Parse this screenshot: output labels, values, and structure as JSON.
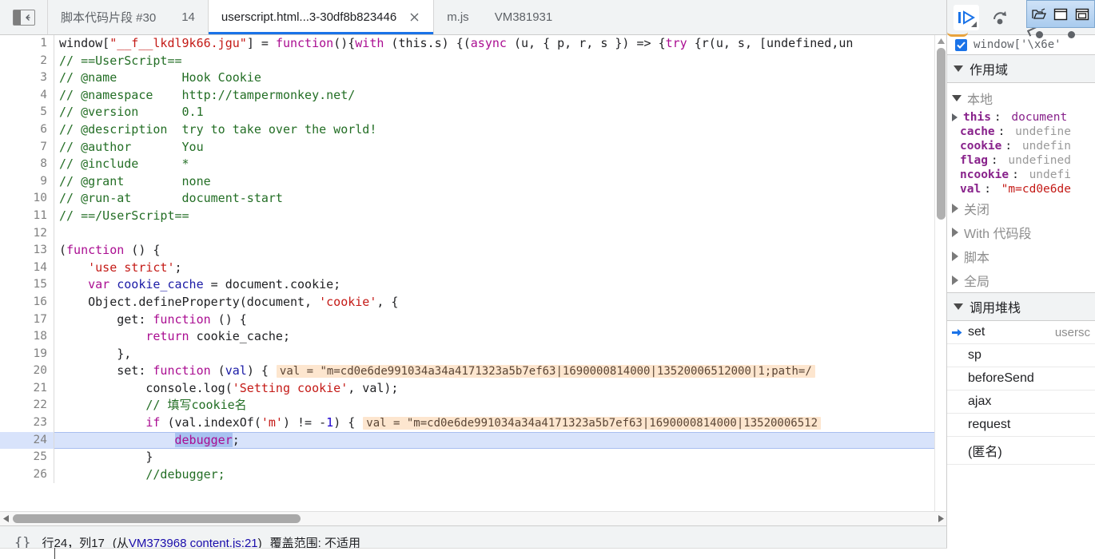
{
  "toolbar": {
    "nav_toggle_title": "收起导航栏",
    "tabs": [
      {
        "label": "脚本代码片段 #30",
        "active": false,
        "closable": false
      },
      {
        "label": "14",
        "active": false,
        "closable": false
      },
      {
        "label": "userscript.html...3-30df8b823446",
        "active": true,
        "closable": true
      },
      {
        "label": "m.js",
        "active": false,
        "closable": false
      },
      {
        "label": "VM381931",
        "active": false,
        "closable": false
      }
    ]
  },
  "editor": {
    "lines": [
      {
        "num": "1",
        "tokens": [
          {
            "t": "window[",
            "c": "t-plain"
          },
          {
            "t": "\"__f__lkdl9k66.jgu\"",
            "c": "t-str"
          },
          {
            "t": "] = ",
            "c": "t-plain"
          },
          {
            "t": "function",
            "c": "t-kw2"
          },
          {
            "t": "(){",
            "c": "t-plain"
          },
          {
            "t": "with",
            "c": "t-kw2"
          },
          {
            "t": " (this.s) {(",
            "c": "t-plain"
          },
          {
            "t": "async",
            "c": "t-kw2"
          },
          {
            "t": " (u, { p, r, s }) => {",
            "c": "t-plain"
          },
          {
            "t": "try",
            "c": "t-kw2"
          },
          {
            "t": " {r(u, s, [undefined,un",
            "c": "t-plain"
          }
        ]
      },
      {
        "num": "2",
        "tokens": [
          {
            "t": "// ==UserScript==",
            "c": "t-com"
          }
        ]
      },
      {
        "num": "3",
        "tokens": [
          {
            "t": "// @name         Hook Cookie",
            "c": "t-com"
          }
        ]
      },
      {
        "num": "4",
        "tokens": [
          {
            "t": "// @namespace    http://tampermonkey.net/",
            "c": "t-com"
          }
        ]
      },
      {
        "num": "5",
        "tokens": [
          {
            "t": "// @version      0.1",
            "c": "t-com"
          }
        ]
      },
      {
        "num": "6",
        "tokens": [
          {
            "t": "// @description  try to take over the world!",
            "c": "t-com"
          }
        ]
      },
      {
        "num": "7",
        "tokens": [
          {
            "t": "// @author       You",
            "c": "t-com"
          }
        ]
      },
      {
        "num": "8",
        "tokens": [
          {
            "t": "// @include      *",
            "c": "t-com"
          }
        ]
      },
      {
        "num": "9",
        "tokens": [
          {
            "t": "// @grant        none",
            "c": "t-com"
          }
        ]
      },
      {
        "num": "10",
        "tokens": [
          {
            "t": "// @run-at       document-start",
            "c": "t-com"
          }
        ]
      },
      {
        "num": "11",
        "tokens": [
          {
            "t": "// ==/UserScript==",
            "c": "t-com"
          }
        ]
      },
      {
        "num": "12",
        "tokens": [
          {
            "t": "",
            "c": "t-plain"
          }
        ]
      },
      {
        "num": "13",
        "tokens": [
          {
            "t": "(",
            "c": "t-plain"
          },
          {
            "t": "function",
            "c": "t-kw2"
          },
          {
            "t": " () {",
            "c": "t-plain"
          }
        ]
      },
      {
        "num": "14",
        "tokens": [
          {
            "t": "    ",
            "c": "t-plain"
          },
          {
            "t": "'use strict'",
            "c": "t-str"
          },
          {
            "t": ";",
            "c": "t-plain"
          }
        ]
      },
      {
        "num": "15",
        "tokens": [
          {
            "t": "    ",
            "c": "t-plain"
          },
          {
            "t": "var",
            "c": "t-kw2"
          },
          {
            "t": " ",
            "c": "t-plain"
          },
          {
            "t": "cookie_cache",
            "c": "t-var"
          },
          {
            "t": " = document.cookie;",
            "c": "t-plain"
          }
        ]
      },
      {
        "num": "16",
        "tokens": [
          {
            "t": "    Object.defineProperty(document, ",
            "c": "t-plain"
          },
          {
            "t": "'cookie'",
            "c": "t-str"
          },
          {
            "t": ", {",
            "c": "t-plain"
          }
        ]
      },
      {
        "num": "17",
        "tokens": [
          {
            "t": "        get: ",
            "c": "t-plain"
          },
          {
            "t": "function",
            "c": "t-kw2"
          },
          {
            "t": " () {",
            "c": "t-plain"
          }
        ]
      },
      {
        "num": "18",
        "tokens": [
          {
            "t": "            ",
            "c": "t-plain"
          },
          {
            "t": "return",
            "c": "t-kw2"
          },
          {
            "t": " cookie_cache;",
            "c": "t-plain"
          }
        ]
      },
      {
        "num": "19",
        "tokens": [
          {
            "t": "        },",
            "c": "t-plain"
          }
        ]
      },
      {
        "num": "20",
        "tokens": [
          {
            "t": "        set: ",
            "c": "t-plain"
          },
          {
            "t": "function",
            "c": "t-kw2"
          },
          {
            "t": " (",
            "c": "t-plain"
          },
          {
            "t": "val",
            "c": "t-var"
          },
          {
            "t": ") {",
            "c": "t-plain"
          }
        ],
        "inline_value": "val = \"m=cd0e6de991034a34a4171323a5b7ef63|1690000814000|13520006512000|1;path=/"
      },
      {
        "num": "21",
        "tokens": [
          {
            "t": "            console.log(",
            "c": "t-plain"
          },
          {
            "t": "'Setting cookie'",
            "c": "t-str"
          },
          {
            "t": ", val);",
            "c": "t-plain"
          }
        ]
      },
      {
        "num": "22",
        "tokens": [
          {
            "t": "            // 填写cookie名",
            "c": "t-com"
          }
        ]
      },
      {
        "num": "23",
        "tokens": [
          {
            "t": "            ",
            "c": "t-plain"
          },
          {
            "t": "if",
            "c": "t-kw2"
          },
          {
            "t": " (val.indexOf(",
            "c": "t-plain"
          },
          {
            "t": "'m'",
            "c": "t-str"
          },
          {
            "t": ") != -",
            "c": "t-plain"
          },
          {
            "t": "1",
            "c": "t-num"
          },
          {
            "t": ") {",
            "c": "t-plain"
          }
        ],
        "inline_value": "val = \"m=cd0e6de991034a34a4171323a5b7ef63|1690000814000|13520006512"
      },
      {
        "num": "24",
        "executing": true,
        "tokens": [
          {
            "t": "                ",
            "c": "t-plain"
          },
          {
            "t": "debugger",
            "c": "t-kw2",
            "selected": true
          },
          {
            "t": ";",
            "c": "t-plain"
          }
        ]
      },
      {
        "num": "25",
        "tokens": [
          {
            "t": "            }",
            "c": "t-plain"
          }
        ]
      },
      {
        "num": "26",
        "tokens": [
          {
            "t": "            //debugger;",
            "c": "t-com"
          }
        ]
      }
    ]
  },
  "statusbar": {
    "pretty_print_icon": "{}",
    "position": "行24，列17",
    "origin_prefix": "(从",
    "origin_link": "VM373968 content.js:21",
    "origin_suffix": ")",
    "coverage": "覆盖范围: 不适用"
  },
  "debugger": {
    "resume_title": "继续执行脚本",
    "step_over_title": "跳过下一个函数调用",
    "window_buttons": [
      "open-folder-icon",
      "restore-window-icon",
      "maximize-window-icon"
    ],
    "breakpoint": {
      "checked": true,
      "label": "window['\\x6e'"
    },
    "scope": {
      "title": "作用域",
      "local_title": "本地",
      "locals": [
        {
          "name": "this",
          "sep": ":",
          "value": "document",
          "value_kind": "obj",
          "expandable": true
        },
        {
          "name": "cache",
          "sep": ":",
          "value": "undefine",
          "value_kind": "plain",
          "expandable": false
        },
        {
          "name": "cookie",
          "sep": ":",
          "value": "undefin",
          "value_kind": "plain",
          "expandable": false
        },
        {
          "name": "flag",
          "sep": ":",
          "value": "undefined",
          "value_kind": "plain",
          "expandable": false
        },
        {
          "name": "ncookie",
          "sep": ":",
          "value": "undefi",
          "value_kind": "plain",
          "expandable": false
        },
        {
          "name": "val",
          "sep": ":",
          "value": "\"m=cd0e6de",
          "value_kind": "str",
          "expandable": false
        }
      ],
      "groups": [
        "关闭",
        "With 代码段",
        "脚本",
        "全局"
      ]
    },
    "call_stack": {
      "title": "调用堆栈",
      "frames": [
        {
          "name": "set",
          "location": "usersc",
          "current": true
        },
        {
          "name": "sp",
          "location": "",
          "current": false
        },
        {
          "name": "beforeSend",
          "location": "",
          "current": false
        },
        {
          "name": "ajax",
          "location": "",
          "current": false
        },
        {
          "name": "request",
          "location": "",
          "current": false
        },
        {
          "name": "(匿名)",
          "location": "",
          "current": false
        }
      ]
    }
  }
}
